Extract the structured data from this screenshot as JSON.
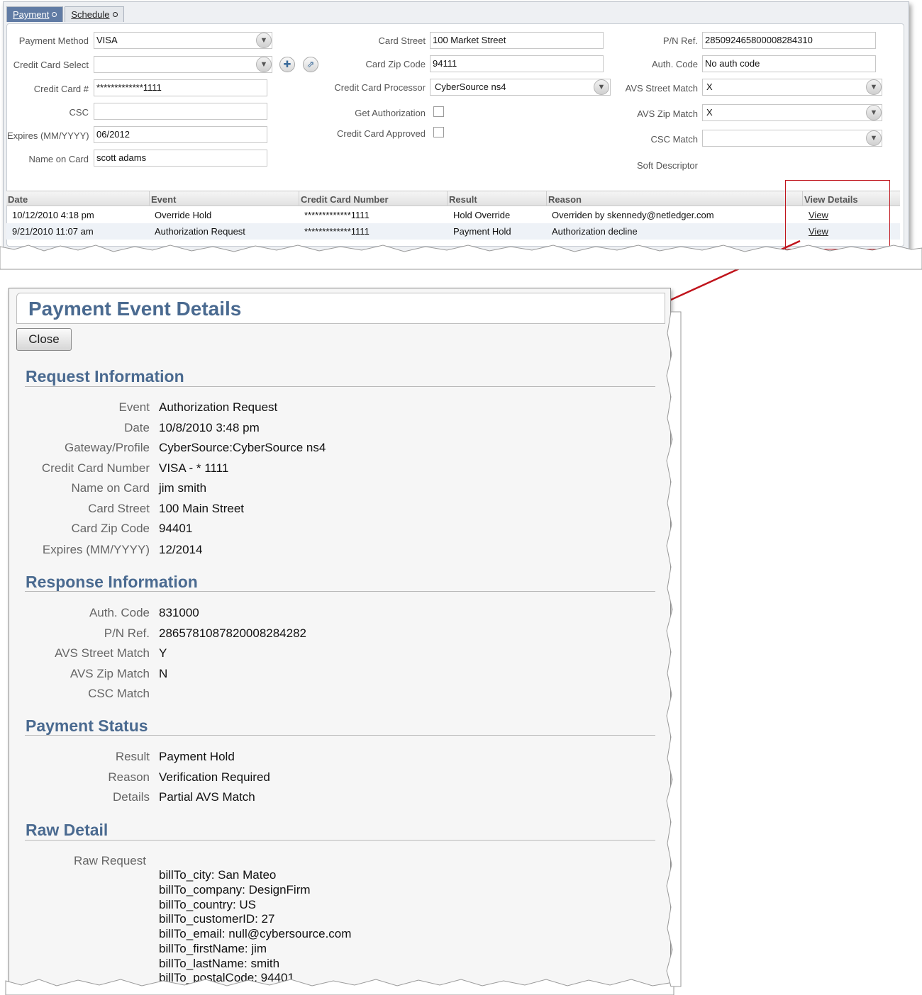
{
  "tabs": [
    {
      "label": "Payment",
      "active": true
    },
    {
      "label": "Schedule",
      "active": false
    }
  ],
  "form": {
    "col1": [
      {
        "label": "Payment Method",
        "value": "VISA",
        "type": "select"
      },
      {
        "label": "Credit Card Select",
        "value": "",
        "type": "select"
      },
      {
        "label": "Credit Card #",
        "value": "*************1111",
        "type": "text"
      },
      {
        "label": "CSC",
        "value": "",
        "type": "text"
      },
      {
        "label": "Expires (MM/YYYY)",
        "value": "06/2012",
        "type": "text"
      },
      {
        "label": "Name on Card",
        "value": "scott adams",
        "type": "text"
      }
    ],
    "col2": [
      {
        "label": "Card Street",
        "value": "100 Market Street",
        "type": "text"
      },
      {
        "label": "Card Zip Code",
        "value": "94111",
        "type": "text"
      },
      {
        "label": "Credit Card Processor",
        "value": "CyberSource ns4",
        "type": "select"
      },
      {
        "label": "Get Authorization",
        "checked": false,
        "type": "checkbox"
      },
      {
        "label": "Credit Card Approved",
        "checked": false,
        "type": "checkbox"
      }
    ],
    "col3": [
      {
        "label": "P/N Ref.",
        "value": "285092465800008284310",
        "type": "text"
      },
      {
        "label": "Auth. Code",
        "value": "No auth code",
        "type": "text"
      },
      {
        "label": "AVS Street Match",
        "value": "X",
        "type": "select"
      },
      {
        "label": "AVS Zip Match",
        "value": "X",
        "type": "select"
      },
      {
        "label": "CSC Match",
        "value": "",
        "type": "select"
      },
      {
        "label": "Soft Descriptor",
        "value": "",
        "type": "static"
      }
    ]
  },
  "grid": {
    "headers": [
      "Date",
      "Event",
      "Credit Card Number",
      "Result",
      "Reason",
      "View Details"
    ],
    "rows": [
      [
        "10/12/2010 4:18 pm",
        "Override Hold",
        "*************1111",
        "Hold Override",
        "Overriden by skennedy@netledger.com",
        "View"
      ],
      [
        "9/21/2010 11:07 am",
        "Authorization Request",
        "*************1111",
        "Payment Hold",
        "Authorization decline",
        "View"
      ]
    ]
  },
  "detail": {
    "title": "Payment Event Details",
    "close_label": "Close",
    "sections": {
      "request": {
        "title": "Request Information",
        "fields": [
          {
            "label": "Event",
            "value": "Authorization Request"
          },
          {
            "label": "Date",
            "value": "10/8/2010 3:48 pm"
          },
          {
            "label": "Gateway/Profile",
            "value": "CyberSource:CyberSource ns4"
          },
          {
            "label": "Credit Card Number",
            "value": "VISA - * 1111"
          },
          {
            "label": "Name on Card",
            "value": "jim smith"
          },
          {
            "label": "Card Street",
            "value": "100 Main Street"
          },
          {
            "label": "Card Zip Code",
            "value": "94401"
          },
          {
            "label": "Expires (MM/YYYY)",
            "value": "12/2014"
          }
        ]
      },
      "response": {
        "title": "Response Information",
        "fields": [
          {
            "label": "Auth. Code",
            "value": "831000"
          },
          {
            "label": "P/N Ref.",
            "value": "2865781087820008284282"
          },
          {
            "label": "AVS Street Match",
            "value": "Y"
          },
          {
            "label": "AVS Zip Match",
            "value": "N"
          },
          {
            "label": "CSC Match",
            "value": ""
          }
        ]
      },
      "status": {
        "title": "Payment Status",
        "fields": [
          {
            "label": "Result",
            "value": "Payment Hold"
          },
          {
            "label": "Reason",
            "value": "Verification Required"
          },
          {
            "label": "Details",
            "value": "Partial AVS Match"
          }
        ]
      },
      "raw": {
        "title": "Raw Detail",
        "label": "Raw Request",
        "lines": [
          "billTo_city: San Mateo",
          "billTo_company: DesignFirm",
          "billTo_country: US",
          "billTo_customerID: 27",
          "billTo_email: null@cybersource.com",
          "billTo_firstName: jim",
          "billTo_lastName: smith",
          "billTo_postalCode: 94401"
        ]
      }
    }
  },
  "colors": {
    "accent": "#4a6a90",
    "active_tab": "#607ba4",
    "highlight": "#c0141c"
  }
}
